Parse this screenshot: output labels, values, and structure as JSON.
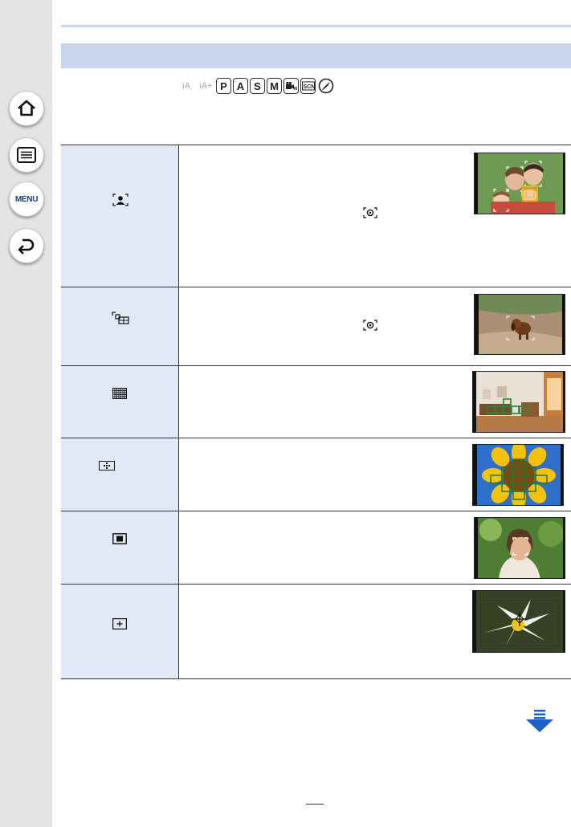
{
  "sidebar": {
    "items": [
      {
        "name": "home",
        "icon": "home-icon"
      },
      {
        "name": "contents",
        "icon": "list-icon"
      },
      {
        "name": "menu",
        "label": "MENU"
      },
      {
        "name": "back",
        "icon": "back-arrow-icon"
      }
    ]
  },
  "modes": {
    "ghost": [
      "iA",
      "iA+"
    ],
    "boxed": [
      "P",
      "A",
      "S",
      "M"
    ],
    "extra": [
      "movie-M",
      "SCN",
      "creative"
    ]
  },
  "af_modes": [
    {
      "icon": "face-eye-detection-icon",
      "thumbnail": "family-faces-photo",
      "metering_icon": true
    },
    {
      "icon": "tracking-icon",
      "thumbnail": "puppy-tracking-photo",
      "metering_icon": true
    },
    {
      "icon": "49-area-icon",
      "thumbnail": "room-interior-photo",
      "metering_icon": false
    },
    {
      "icon": "custom-multi-icon",
      "thumbnail": "sunflower-photo",
      "metering_icon": false
    },
    {
      "icon": "1-area-icon",
      "thumbnail": "woman-portrait-photo",
      "metering_icon": false
    },
    {
      "icon": "pinpoint-icon",
      "thumbnail": "white-flower-photo",
      "metering_icon": false
    }
  ],
  "colors": {
    "header_band": "#c9d7ee",
    "table_label_cell": "#e2e9f6",
    "nav_accent": "#1a3d7a",
    "next_arrow": "#1f5fc8"
  }
}
